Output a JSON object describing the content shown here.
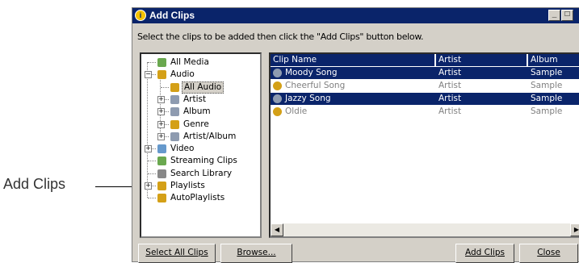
{
  "callout": {
    "label": "Add Clips"
  },
  "window": {
    "title": "Add Clips",
    "instruction": "Select the clips to be added then click the \"Add Clips\" button below.",
    "controls": {
      "minimize": "_",
      "maximize": "□"
    }
  },
  "tree": [
    {
      "label": "All Media"
    },
    {
      "label": "Audio",
      "expander": "−"
    },
    {
      "label": "All Audio",
      "selected": true
    },
    {
      "label": "Artist",
      "expander": "+"
    },
    {
      "label": "Album",
      "expander": "+"
    },
    {
      "label": "Genre",
      "expander": "+"
    },
    {
      "label": "Artist/Album",
      "expander": "+"
    },
    {
      "label": "Video",
      "expander": "+"
    },
    {
      "label": "Streaming Clips"
    },
    {
      "label": "Search Library"
    },
    {
      "label": "Playlists",
      "expander": "+"
    },
    {
      "label": "AutoPlaylists"
    }
  ],
  "table": {
    "columns": [
      "Clip Name",
      "Artist",
      "Album"
    ],
    "rows": [
      {
        "name": "Moody Song",
        "artist": "Artist",
        "album": "Sample",
        "selected": true
      },
      {
        "name": "Cheerful Song",
        "artist": "Artist",
        "album": "Sample",
        "selected": false
      },
      {
        "name": "Jazzy Song",
        "artist": "Artist",
        "album": "Sample",
        "selected": true
      },
      {
        "name": "Oldie",
        "artist": "Artist",
        "album": "Sample",
        "selected": false
      }
    ]
  },
  "buttons": {
    "select_all": "Select All Clips",
    "browse": "Browse...",
    "add_clips": "Add Clips",
    "close": "Close"
  },
  "colors": {
    "selection": "#0a246a",
    "face": "#d4d0c8"
  }
}
